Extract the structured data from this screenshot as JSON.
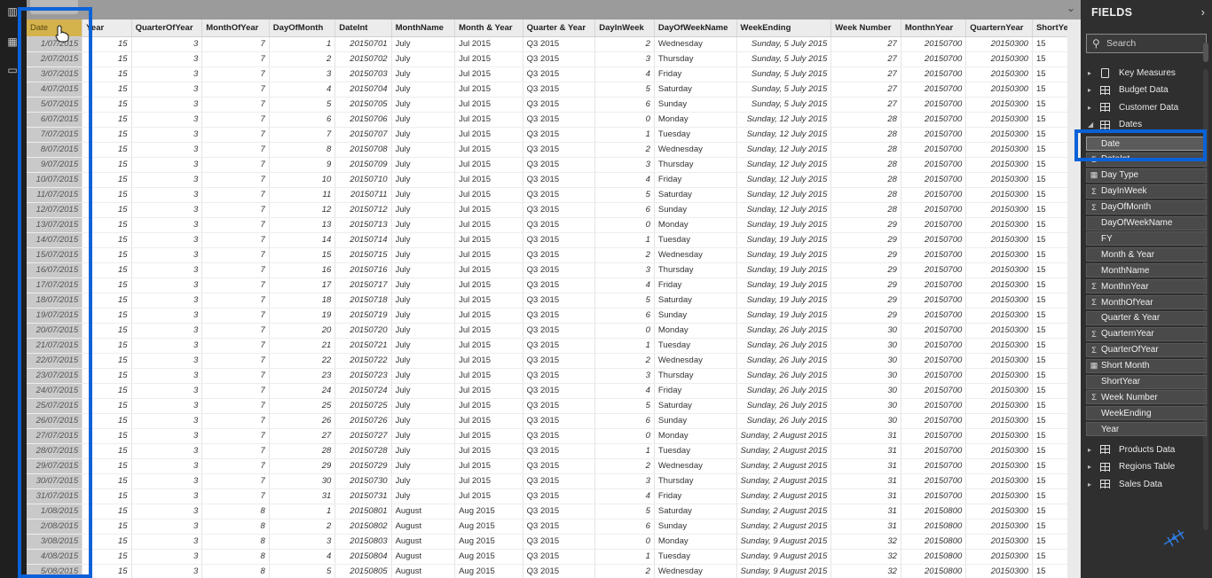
{
  "table": {
    "columns": [
      {
        "key": "date",
        "label": "Date",
        "width": 63,
        "cls": "date"
      },
      {
        "key": "year",
        "label": "Year",
        "width": 57,
        "cls": "num"
      },
      {
        "key": "qoy",
        "label": "QuarterOfYear",
        "width": 80,
        "cls": "num"
      },
      {
        "key": "moy",
        "label": "MonthOfYear",
        "width": 76,
        "cls": "num"
      },
      {
        "key": "dom",
        "label": "DayOfMonth",
        "width": 75,
        "cls": "num"
      },
      {
        "key": "dateint",
        "label": "DateInt",
        "width": 64,
        "cls": "num"
      },
      {
        "key": "mname",
        "label": "MonthName",
        "width": 72,
        "cls": "txt"
      },
      {
        "key": "my",
        "label": "Month & Year",
        "width": 77,
        "cls": "txt"
      },
      {
        "key": "qy",
        "label": "Quarter & Year",
        "width": 82,
        "cls": "txt"
      },
      {
        "key": "diw",
        "label": "DayInWeek",
        "width": 67,
        "cls": "num"
      },
      {
        "key": "downame",
        "label": "DayOfWeekName",
        "width": 93,
        "cls": "txt"
      },
      {
        "key": "we",
        "label": "WeekEnding",
        "width": 103,
        "cls": "we"
      },
      {
        "key": "wn",
        "label": "Week Number",
        "width": 79,
        "cls": "num"
      },
      {
        "key": "miy",
        "label": "MonthnYear",
        "width": 74,
        "cls": "num"
      },
      {
        "key": "qiy",
        "label": "QuarternYear",
        "width": 75,
        "cls": "num"
      },
      {
        "key": "sy",
        "label": "ShortYear",
        "width": 48,
        "cls": "txt"
      }
    ],
    "rows": [
      [
        "1/07/2015",
        "15",
        "3",
        "7",
        "1",
        "20150701",
        "July",
        "Jul 2015",
        "Q3 2015",
        "2",
        "Wednesday",
        "Sunday, 5 July 2015",
        "27",
        "20150700",
        "20150300",
        "15"
      ],
      [
        "2/07/2015",
        "15",
        "3",
        "7",
        "2",
        "20150702",
        "July",
        "Jul 2015",
        "Q3 2015",
        "3",
        "Thursday",
        "Sunday, 5 July 2015",
        "27",
        "20150700",
        "20150300",
        "15"
      ],
      [
        "3/07/2015",
        "15",
        "3",
        "7",
        "3",
        "20150703",
        "July",
        "Jul 2015",
        "Q3 2015",
        "4",
        "Friday",
        "Sunday, 5 July 2015",
        "27",
        "20150700",
        "20150300",
        "15"
      ],
      [
        "4/07/2015",
        "15",
        "3",
        "7",
        "4",
        "20150704",
        "July",
        "Jul 2015",
        "Q3 2015",
        "5",
        "Saturday",
        "Sunday, 5 July 2015",
        "27",
        "20150700",
        "20150300",
        "15"
      ],
      [
        "5/07/2015",
        "15",
        "3",
        "7",
        "5",
        "20150705",
        "July",
        "Jul 2015",
        "Q3 2015",
        "6",
        "Sunday",
        "Sunday, 5 July 2015",
        "27",
        "20150700",
        "20150300",
        "15"
      ],
      [
        "6/07/2015",
        "15",
        "3",
        "7",
        "6",
        "20150706",
        "July",
        "Jul 2015",
        "Q3 2015",
        "0",
        "Monday",
        "Sunday, 12 July 2015",
        "28",
        "20150700",
        "20150300",
        "15"
      ],
      [
        "7/07/2015",
        "15",
        "3",
        "7",
        "7",
        "20150707",
        "July",
        "Jul 2015",
        "Q3 2015",
        "1",
        "Tuesday",
        "Sunday, 12 July 2015",
        "28",
        "20150700",
        "20150300",
        "15"
      ],
      [
        "8/07/2015",
        "15",
        "3",
        "7",
        "8",
        "20150708",
        "July",
        "Jul 2015",
        "Q3 2015",
        "2",
        "Wednesday",
        "Sunday, 12 July 2015",
        "28",
        "20150700",
        "20150300",
        "15"
      ],
      [
        "9/07/2015",
        "15",
        "3",
        "7",
        "9",
        "20150709",
        "July",
        "Jul 2015",
        "Q3 2015",
        "3",
        "Thursday",
        "Sunday, 12 July 2015",
        "28",
        "20150700",
        "20150300",
        "15"
      ],
      [
        "10/07/2015",
        "15",
        "3",
        "7",
        "10",
        "20150710",
        "July",
        "Jul 2015",
        "Q3 2015",
        "4",
        "Friday",
        "Sunday, 12 July 2015",
        "28",
        "20150700",
        "20150300",
        "15"
      ],
      [
        "11/07/2015",
        "15",
        "3",
        "7",
        "11",
        "20150711",
        "July",
        "Jul 2015",
        "Q3 2015",
        "5",
        "Saturday",
        "Sunday, 12 July 2015",
        "28",
        "20150700",
        "20150300",
        "15"
      ],
      [
        "12/07/2015",
        "15",
        "3",
        "7",
        "12",
        "20150712",
        "July",
        "Jul 2015",
        "Q3 2015",
        "6",
        "Sunday",
        "Sunday, 12 July 2015",
        "28",
        "20150700",
        "20150300",
        "15"
      ],
      [
        "13/07/2015",
        "15",
        "3",
        "7",
        "13",
        "20150713",
        "July",
        "Jul 2015",
        "Q3 2015",
        "0",
        "Monday",
        "Sunday, 19 July 2015",
        "29",
        "20150700",
        "20150300",
        "15"
      ],
      [
        "14/07/2015",
        "15",
        "3",
        "7",
        "14",
        "20150714",
        "July",
        "Jul 2015",
        "Q3 2015",
        "1",
        "Tuesday",
        "Sunday, 19 July 2015",
        "29",
        "20150700",
        "20150300",
        "15"
      ],
      [
        "15/07/2015",
        "15",
        "3",
        "7",
        "15",
        "20150715",
        "July",
        "Jul 2015",
        "Q3 2015",
        "2",
        "Wednesday",
        "Sunday, 19 July 2015",
        "29",
        "20150700",
        "20150300",
        "15"
      ],
      [
        "16/07/2015",
        "15",
        "3",
        "7",
        "16",
        "20150716",
        "July",
        "Jul 2015",
        "Q3 2015",
        "3",
        "Thursday",
        "Sunday, 19 July 2015",
        "29",
        "20150700",
        "20150300",
        "15"
      ],
      [
        "17/07/2015",
        "15",
        "3",
        "7",
        "17",
        "20150717",
        "July",
        "Jul 2015",
        "Q3 2015",
        "4",
        "Friday",
        "Sunday, 19 July 2015",
        "29",
        "20150700",
        "20150300",
        "15"
      ],
      [
        "18/07/2015",
        "15",
        "3",
        "7",
        "18",
        "20150718",
        "July",
        "Jul 2015",
        "Q3 2015",
        "5",
        "Saturday",
        "Sunday, 19 July 2015",
        "29",
        "20150700",
        "20150300",
        "15"
      ],
      [
        "19/07/2015",
        "15",
        "3",
        "7",
        "19",
        "20150719",
        "July",
        "Jul 2015",
        "Q3 2015",
        "6",
        "Sunday",
        "Sunday, 19 July 2015",
        "29",
        "20150700",
        "20150300",
        "15"
      ],
      [
        "20/07/2015",
        "15",
        "3",
        "7",
        "20",
        "20150720",
        "July",
        "Jul 2015",
        "Q3 2015",
        "0",
        "Monday",
        "Sunday, 26 July 2015",
        "30",
        "20150700",
        "20150300",
        "15"
      ],
      [
        "21/07/2015",
        "15",
        "3",
        "7",
        "21",
        "20150721",
        "July",
        "Jul 2015",
        "Q3 2015",
        "1",
        "Tuesday",
        "Sunday, 26 July 2015",
        "30",
        "20150700",
        "20150300",
        "15"
      ],
      [
        "22/07/2015",
        "15",
        "3",
        "7",
        "22",
        "20150722",
        "July",
        "Jul 2015",
        "Q3 2015",
        "2",
        "Wednesday",
        "Sunday, 26 July 2015",
        "30",
        "20150700",
        "20150300",
        "15"
      ],
      [
        "23/07/2015",
        "15",
        "3",
        "7",
        "23",
        "20150723",
        "July",
        "Jul 2015",
        "Q3 2015",
        "3",
        "Thursday",
        "Sunday, 26 July 2015",
        "30",
        "20150700",
        "20150300",
        "15"
      ],
      [
        "24/07/2015",
        "15",
        "3",
        "7",
        "24",
        "20150724",
        "July",
        "Jul 2015",
        "Q3 2015",
        "4",
        "Friday",
        "Sunday, 26 July 2015",
        "30",
        "20150700",
        "20150300",
        "15"
      ],
      [
        "25/07/2015",
        "15",
        "3",
        "7",
        "25",
        "20150725",
        "July",
        "Jul 2015",
        "Q3 2015",
        "5",
        "Saturday",
        "Sunday, 26 July 2015",
        "30",
        "20150700",
        "20150300",
        "15"
      ],
      [
        "26/07/2015",
        "15",
        "3",
        "7",
        "26",
        "20150726",
        "July",
        "Jul 2015",
        "Q3 2015",
        "6",
        "Sunday",
        "Sunday, 26 July 2015",
        "30",
        "20150700",
        "20150300",
        "15"
      ],
      [
        "27/07/2015",
        "15",
        "3",
        "7",
        "27",
        "20150727",
        "July",
        "Jul 2015",
        "Q3 2015",
        "0",
        "Monday",
        "Sunday, 2 August 2015",
        "31",
        "20150700",
        "20150300",
        "15"
      ],
      [
        "28/07/2015",
        "15",
        "3",
        "7",
        "28",
        "20150728",
        "July",
        "Jul 2015",
        "Q3 2015",
        "1",
        "Tuesday",
        "Sunday, 2 August 2015",
        "31",
        "20150700",
        "20150300",
        "15"
      ],
      [
        "29/07/2015",
        "15",
        "3",
        "7",
        "29",
        "20150729",
        "July",
        "Jul 2015",
        "Q3 2015",
        "2",
        "Wednesday",
        "Sunday, 2 August 2015",
        "31",
        "20150700",
        "20150300",
        "15"
      ],
      [
        "30/07/2015",
        "15",
        "3",
        "7",
        "30",
        "20150730",
        "July",
        "Jul 2015",
        "Q3 2015",
        "3",
        "Thursday",
        "Sunday, 2 August 2015",
        "31",
        "20150700",
        "20150300",
        "15"
      ],
      [
        "31/07/2015",
        "15",
        "3",
        "7",
        "31",
        "20150731",
        "July",
        "Jul 2015",
        "Q3 2015",
        "4",
        "Friday",
        "Sunday, 2 August 2015",
        "31",
        "20150700",
        "20150300",
        "15"
      ],
      [
        "1/08/2015",
        "15",
        "3",
        "8",
        "1",
        "20150801",
        "August",
        "Aug 2015",
        "Q3 2015",
        "5",
        "Saturday",
        "Sunday, 2 August 2015",
        "31",
        "20150800",
        "20150300",
        "15"
      ],
      [
        "2/08/2015",
        "15",
        "3",
        "8",
        "2",
        "20150802",
        "August",
        "Aug 2015",
        "Q3 2015",
        "6",
        "Sunday",
        "Sunday, 2 August 2015",
        "31",
        "20150800",
        "20150300",
        "15"
      ],
      [
        "3/08/2015",
        "15",
        "3",
        "8",
        "3",
        "20150803",
        "August",
        "Aug 2015",
        "Q3 2015",
        "0",
        "Monday",
        "Sunday, 9 August 2015",
        "32",
        "20150800",
        "20150300",
        "15"
      ],
      [
        "4/08/2015",
        "15",
        "3",
        "8",
        "4",
        "20150804",
        "August",
        "Aug 2015",
        "Q3 2015",
        "1",
        "Tuesday",
        "Sunday, 9 August 2015",
        "32",
        "20150800",
        "20150300",
        "15"
      ],
      [
        "5/08/2015",
        "15",
        "3",
        "8",
        "5",
        "20150805",
        "August",
        "Aug 2015",
        "Q3 2015",
        "2",
        "Wednesday",
        "Sunday, 9 August 2015",
        "32",
        "20150800",
        "20150300",
        "15"
      ]
    ]
  },
  "fields_pane": {
    "title": "FIELDS",
    "collapse_icon": "chevron-right-icon",
    "search_placeholder": "Search",
    "tables_top": [
      {
        "name": "Key Measures",
        "icon": "calculator-icon"
      },
      {
        "name": "Budget Data",
        "icon": "table-icon"
      },
      {
        "name": "Customer Data",
        "icon": "table-icon"
      },
      {
        "name": "Dates",
        "icon": "table-icon",
        "expanded": true
      }
    ],
    "date_fields": [
      {
        "name": "Date",
        "type": "",
        "selected": true
      },
      {
        "name": "DateInt",
        "type": "sum"
      },
      {
        "name": "Day Type",
        "type": "calc"
      },
      {
        "name": "DayInWeek",
        "type": "sum"
      },
      {
        "name": "DayOfMonth",
        "type": "sum"
      },
      {
        "name": "DayOfWeekName",
        "type": ""
      },
      {
        "name": "FY",
        "type": ""
      },
      {
        "name": "Month & Year",
        "type": ""
      },
      {
        "name": "MonthName",
        "type": ""
      },
      {
        "name": "MonthnYear",
        "type": "sum"
      },
      {
        "name": "MonthOfYear",
        "type": "sum"
      },
      {
        "name": "Quarter & Year",
        "type": ""
      },
      {
        "name": "QuarternYear",
        "type": "sum"
      },
      {
        "name": "QuarterOfYear",
        "type": "sum"
      },
      {
        "name": "Short Month",
        "type": "calc"
      },
      {
        "name": "ShortYear",
        "type": ""
      },
      {
        "name": "Week Number",
        "type": "sum"
      },
      {
        "name": "WeekEnding",
        "type": ""
      },
      {
        "name": "Year",
        "type": ""
      }
    ],
    "tables_bottom": [
      {
        "name": "Products Data",
        "icon": "table-icon"
      },
      {
        "name": "Regions Table",
        "icon": "table-icon"
      },
      {
        "name": "Sales Data",
        "icon": "table-icon"
      }
    ]
  },
  "colors": {
    "highlight": "#0a62d8",
    "selected_header": "#d4b24c",
    "pane_bg": "#2f2f2f"
  }
}
